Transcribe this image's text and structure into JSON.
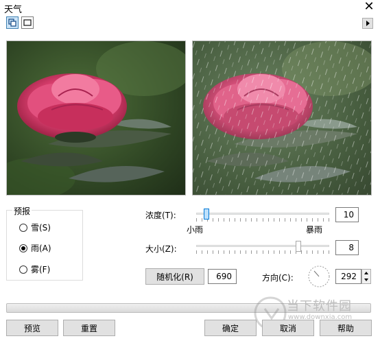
{
  "window": {
    "title": "天气"
  },
  "toolbar": {
    "split_icon": "split-view-icon",
    "single_icon": "single-view-icon",
    "arrow_icon": "right-arrow-icon"
  },
  "forecast": {
    "title": "预报",
    "options": [
      {
        "label": "雪(S)",
        "checked": false
      },
      {
        "label": "雨(A)",
        "checked": true
      },
      {
        "label": "雾(F)",
        "checked": false
      }
    ]
  },
  "density": {
    "label": "浓度(T):",
    "min_label": "小雨",
    "max_label": "暴雨",
    "value": "10",
    "level_fraction": 0.06
  },
  "size": {
    "label": "大小(Z):",
    "value": "8",
    "level_fraction": 0.78
  },
  "randomize": {
    "button_label": "随机化(R)",
    "value": "690"
  },
  "direction": {
    "label": "方向(C):",
    "value": "292"
  },
  "buttons": {
    "preview": "预览",
    "reset": "重置",
    "ok": "确定",
    "cancel": "取消",
    "help": "帮助"
  },
  "watermark": {
    "brand": "当下软件园",
    "url": "www.downxia.com"
  }
}
